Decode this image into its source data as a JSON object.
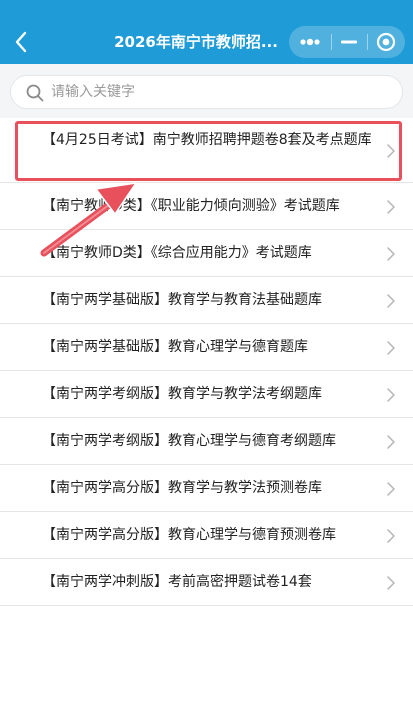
{
  "header": {
    "title": "2026年南宁市教师招...",
    "background": "#1f9bd7",
    "back_icon": "chevron-left",
    "more_icon": "more-dots",
    "minimize_icon": "minus",
    "close_icon": "target-circle"
  },
  "search": {
    "placeholder": "请输入关键字",
    "value": "",
    "icon": "search"
  },
  "items": [
    {
      "label": "【4月25日考试】南宁教师招聘押题卷8套及考点题库"
    },
    {
      "label": "【南宁教师D类】《职业能力倾向测验》考试题库"
    },
    {
      "label": "【南宁教师D类】《综合应用能力》考试题库"
    },
    {
      "label": "【南宁两学基础版】教育学与教育法基础题库"
    },
    {
      "label": "【南宁两学基础版】教育心理学与德育题库"
    },
    {
      "label": "【南宁两学考纲版】教育学与教学法考纲题库"
    },
    {
      "label": "【南宁两学考纲版】教育心理学与德育考纲题库"
    },
    {
      "label": "【南宁两学高分版】教育学与教学法预测卷库"
    },
    {
      "label": "【南宁两学高分版】教育心理学与德育预测卷库"
    },
    {
      "label": "【南宁两学冲刺版】考前高密押题试卷14套"
    }
  ],
  "annotation": {
    "color": "#e8505b",
    "highlighted_item": 0
  }
}
